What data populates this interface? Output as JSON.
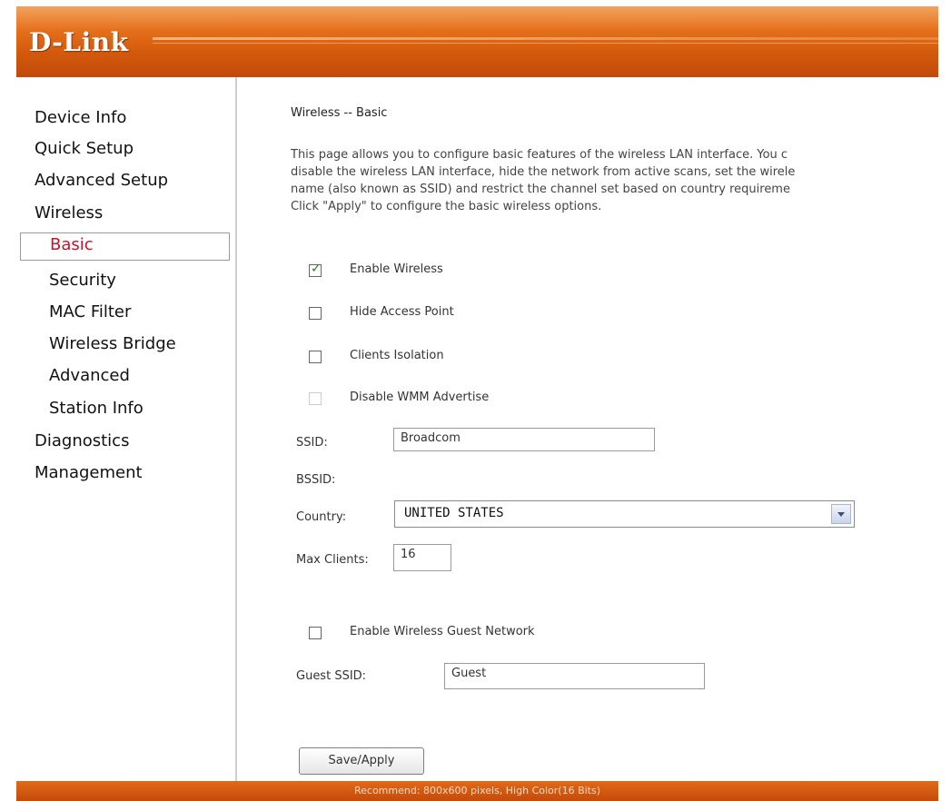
{
  "header": {
    "logo": "D-Link"
  },
  "sidebar": {
    "items": [
      {
        "label": "Device Info"
      },
      {
        "label": "Quick Setup"
      },
      {
        "label": "Advanced Setup"
      },
      {
        "label": "Wireless"
      },
      {
        "label": "Basic"
      },
      {
        "label": "Security"
      },
      {
        "label": "MAC Filter"
      },
      {
        "label": "Wireless Bridge"
      },
      {
        "label": "Advanced"
      },
      {
        "label": "Station Info"
      },
      {
        "label": "Diagnostics"
      },
      {
        "label": "Management"
      }
    ],
    "active_item": "Basic"
  },
  "main": {
    "title": "Wireless -- Basic",
    "description_lines": [
      "This page allows you to configure basic features of the wireless LAN interface. You c",
      "disable the wireless LAN interface, hide the network from active scans, set the wirele",
      "name (also known as SSID) and restrict the channel set based on country requireme",
      "Click \"Apply\" to configure the basic wireless options."
    ],
    "checkboxes": [
      {
        "label": "Enable Wireless",
        "checked": true,
        "disabled": false
      },
      {
        "label": "Hide Access Point",
        "checked": false,
        "disabled": false
      },
      {
        "label": "Clients Isolation",
        "checked": false,
        "disabled": false
      },
      {
        "label": "Disable WMM Advertise",
        "checked": false,
        "disabled": true
      }
    ],
    "ssid_label": "SSID:",
    "ssid_value": "Broadcom",
    "bssid_label": "BSSID:",
    "country_label": "Country:",
    "country_value": "UNITED STATES",
    "max_clients_label": "Max Clients:",
    "max_clients_value": "16",
    "guest_checkbox": {
      "label": "Enable Wireless Guest Network",
      "checked": false
    },
    "guest_ssid_label": "Guest SSID:",
    "guest_ssid_value": "Guest",
    "save_button": "Save/Apply"
  },
  "footer": {
    "text": "Recommend: 800x600 pixels, High Color(16 Bits)"
  },
  "colors": {
    "brand_orange": "#d35a0c",
    "active_link": "#c4122c"
  }
}
